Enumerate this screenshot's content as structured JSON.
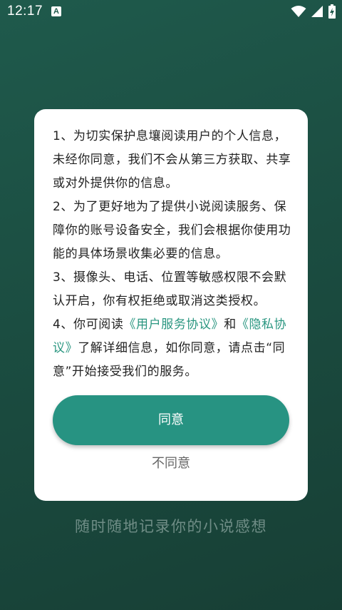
{
  "status_bar": {
    "time": "12:17",
    "notification_glyph": "A",
    "icons": [
      "wifi-icon",
      "signal-icon",
      "battery-icon"
    ]
  },
  "dialog": {
    "paragraphs": [
      {
        "text": "1、为切实保护息壤阅读用户的个人信息，未经你同意，我们不会从第三方获取、共享或对外提供你的信息。"
      },
      {
        "text": " 2、为了更好地为了提供小说阅读服务、保障你的账号设备安全，我们会根据你使用功能的具体场景收集必要的信息。"
      },
      {
        "text": " 3、摄像头、电话、位置等敏感权限不会默认开启，你有权拒绝或取消这类授权。"
      }
    ],
    "para4": {
      "prefix": " 4、你可阅读",
      "user_agreement_link": "《用户服务协议》",
      "and": "和",
      "privacy_link": "《隐私协议》",
      "suffix": "了解详细信息，如你同意，请点击“同意”开始接受我们的服务。"
    },
    "agree_label": "同意",
    "disagree_label": "不同意"
  },
  "slogan": "随时随地记录你的小说感想",
  "colors": {
    "background": "#1b4d41",
    "accent": "#279382",
    "link": "#2a9680",
    "slogan": "#6f8d86"
  }
}
